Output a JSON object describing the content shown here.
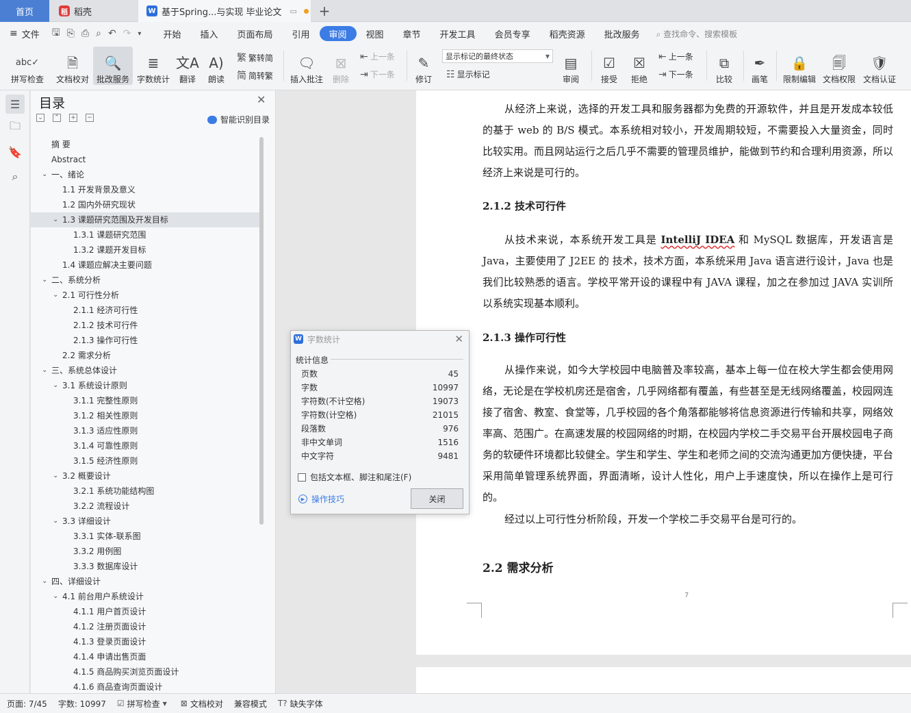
{
  "tabs": {
    "home": "首页",
    "daoke": "稻壳",
    "doc": "基于Spring...与实现 毕业论文"
  },
  "menubar": {
    "file": "文件",
    "items": [
      "开始",
      "插入",
      "页面布局",
      "引用",
      "审阅",
      "视图",
      "章节",
      "开发工具",
      "会员专享",
      "稻壳资源",
      "批改服务"
    ],
    "active_index": 4,
    "search": "查找命令、搜索模板"
  },
  "ribbon": {
    "spellcheck": "拼写检查",
    "proofread": "文档校对",
    "correction": "批改服务",
    "wordcount": "字数统计",
    "translate": "翻译",
    "read": "朗读",
    "to_trad": "繁转简",
    "to_simp": "简转繁",
    "insert_comment": "插入批注",
    "delete": "删除",
    "prev": "上一条",
    "next": "下一条",
    "revise": "修订",
    "markup_select": "显示标记的最终状态",
    "show_markup": "显示标记",
    "review": "审阅",
    "accept": "接受",
    "reject": "拒绝",
    "prev2": "上一条",
    "next2": "下一条",
    "compare": "比较",
    "pen": "画笔",
    "restrict": "限制编辑",
    "rights": "文档权限",
    "certify": "文档认证"
  },
  "toc": {
    "title": "目录",
    "smart": "智能识别目录",
    "items": [
      {
        "label": "摘    要",
        "level": 1,
        "chev": false
      },
      {
        "label": "Abstract",
        "level": 1,
        "chev": false
      },
      {
        "label": "一、绪论",
        "level": 1,
        "chev": true
      },
      {
        "label": "1.1 开发背景及意义",
        "level": 2,
        "chev": false
      },
      {
        "label": "1.2  国内外研究现状",
        "level": 2,
        "chev": false
      },
      {
        "label": "1.3  课题研究范围及开发目标",
        "level": 2,
        "chev": true,
        "sel": true
      },
      {
        "label": "1.3.1  课题研究范围",
        "level": 3,
        "chev": false
      },
      {
        "label": "1.3.2  课题开发目标",
        "level": 3,
        "chev": false
      },
      {
        "label": "1.4  课题应解决主要问题",
        "level": 2,
        "chev": false
      },
      {
        "label": "二、系统分析",
        "level": 1,
        "chev": true
      },
      {
        "label": "2.1 可行性分析",
        "level": 2,
        "chev": true
      },
      {
        "label": "2.1.1  经济可行性",
        "level": 3,
        "chev": false
      },
      {
        "label": "2.1.2    技术可行件",
        "level": 3,
        "chev": false
      },
      {
        "label": "2.1.3  操作可行性",
        "level": 3,
        "chev": false
      },
      {
        "label": "2.2 需求分析",
        "level": 2,
        "chev": false
      },
      {
        "label": "三、系统总体设计",
        "level": 1,
        "chev": true
      },
      {
        "label": "3.1 系统设计原则",
        "level": 2,
        "chev": true
      },
      {
        "label": "3.1.1 完整性原则",
        "level": 3,
        "chev": false
      },
      {
        "label": "3.1.2 相关性原则",
        "level": 3,
        "chev": false
      },
      {
        "label": "3.1.3  适应性原则",
        "level": 3,
        "chev": false
      },
      {
        "label": "3.1.4 可靠性原则",
        "level": 3,
        "chev": false
      },
      {
        "label": "3.1.5 经济性原则",
        "level": 3,
        "chev": false
      },
      {
        "label": "3.2  概要设计",
        "level": 2,
        "chev": true
      },
      {
        "label": "3.2.1  系统功能结构图",
        "level": 3,
        "chev": false
      },
      {
        "label": "3.2.2  流程设计",
        "level": 3,
        "chev": false
      },
      {
        "label": "3.3  详细设计",
        "level": 2,
        "chev": true
      },
      {
        "label": "3.3.1  实体-联系图",
        "level": 3,
        "chev": false
      },
      {
        "label": "3.3.2  用例图",
        "level": 3,
        "chev": false
      },
      {
        "label": "3.3.3 数据库设计",
        "level": 3,
        "chev": false
      },
      {
        "label": "四、详细设计",
        "level": 1,
        "chev": true
      },
      {
        "label": "4.1 前台用户系统设计",
        "level": 2,
        "chev": true
      },
      {
        "label": "4.1.1 用户首页设计",
        "level": 3,
        "chev": false
      },
      {
        "label": "4.1.2 注册页面设计",
        "level": 3,
        "chev": false
      },
      {
        "label": "4.1.3 登录页面设计",
        "level": 3,
        "chev": false
      },
      {
        "label": "4.1.4 申请出售页面",
        "level": 3,
        "chev": false
      },
      {
        "label": "4.1.5 商品购买浏览页面设计",
        "level": 3,
        "chev": false
      },
      {
        "label": "4.1.6 商品查询页面设计",
        "level": 3,
        "chev": false
      }
    ]
  },
  "doc": {
    "p1": "从经济上来说，选择的开发工具和服务器都为免费的开源软件，并且是开发成本较低的基于 web 的 B/S 模式。本系统相对较小，开发周期较短，不需要投入大量资金，同时比较实用。而且网站运行之后几乎不需要的管理员维护，能做到节约和合理利用资源，所以经济上来说是可行的。",
    "h_212": "2.1.2    技术可行件",
    "p2_a": "从技术来说，本系统开发工具是 ",
    "p2_term": "IntelliJ IDEA",
    "p2_b": " 和 MySQL 数据库，开发语言是 Java，主要使用了  J2EE 的  技术，技术方面，本系统采用 Java 语言进行设计，Java 也是我们比较熟悉的语言。学校平常开设的课程中有 JAVA 课程，加之在参加过 JAVA 实训所以系统实现基本顺利。",
    "h_213": "2.1.3  操作可行性",
    "p3": "从操作来说，如今大学校园中电脑普及率较高，基本上每一位在校大学生都会使用网络，无论是在学校机房还是宿舍，几乎网络都有覆盖，有些甚至是无线网络覆盖，校园网连接了宿舍、教室、食堂等，几乎校园的各个角落都能够将信息资源进行传输和共享，网络效率高、范围广。在高速发展的校园网络的时期，在校园内学校二手交易平台开展校园电子商务的软硬件环境都比较健全。学生和学生、学生和老师之间的交流沟通更加方便快捷，平台采用简单管理系统界面，界面清晰，设计人性化，用户上手速度快，所以在操作上是可行的。",
    "p4": "经过以上可行性分析阶段，开发一个学校二手交易平台是可行的。",
    "h_22": "2.2 需求分析",
    "page_number": "7"
  },
  "dialog": {
    "title": "字数统计",
    "section": "统计信息",
    "rows": [
      {
        "label": "页数",
        "value": "45"
      },
      {
        "label": "字数",
        "value": "10997"
      },
      {
        "label": "字符数(不计空格)",
        "value": "19073"
      },
      {
        "label": "字符数(计空格)",
        "value": "21015"
      },
      {
        "label": "段落数",
        "value": "976"
      },
      {
        "label": "非中文单词",
        "value": "1516"
      },
      {
        "label": "中文字符",
        "value": "9481"
      }
    ],
    "checkbox": "包括文本框、脚注和尾注(F)",
    "tips": "操作技巧",
    "close": "关闭"
  },
  "status": {
    "page": "页面: 7/45",
    "words": "字数: 10997",
    "spell": "拼写检查",
    "proof": "文档校对",
    "compat": "兼容模式",
    "missing_font": "缺失字体"
  }
}
